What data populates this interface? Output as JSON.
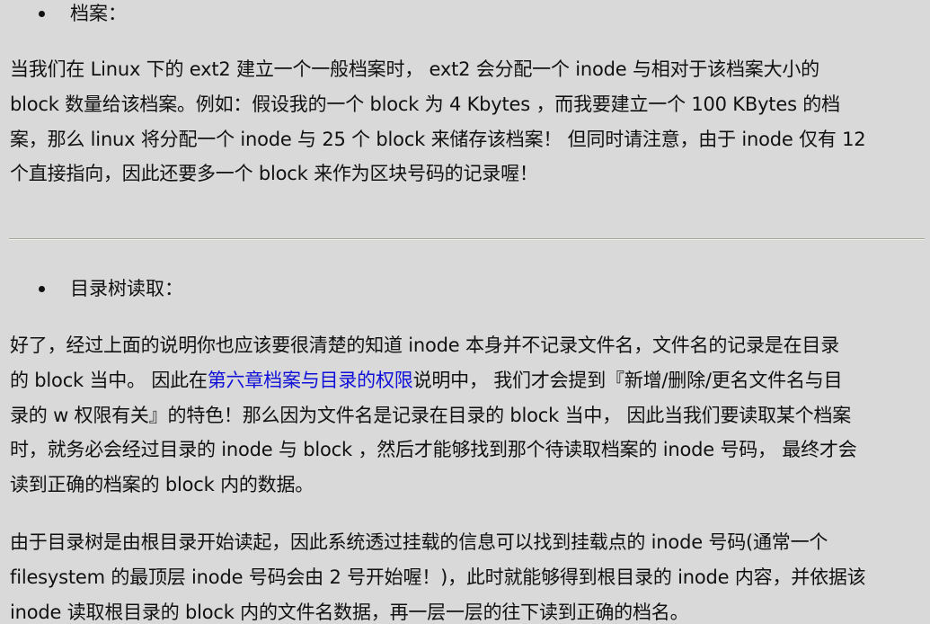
{
  "section1": {
    "bullet": "档案：",
    "lines": [
      "当我们在 Linux 下的 ext2 建立一个一般档案时， ext2 会分配一个 inode 与相对于该档案大小的",
      "block 数量给该档案。例如：假设我的一个 block 为 4 Kbytes ，而我要建立一个 100 KBytes 的档",
      "案，那么 linux 将分配一个 inode 与 25 个 block 来储存该档案！ 但同时请注意，由于 inode 仅有 12",
      "个直接指向，因此还要多一个 block 来作为区块号码的记录喔！"
    ]
  },
  "section2": {
    "bullet": "目录树读取：",
    "para1": {
      "line1": "好了，经过上面的说明你也应该要很清楚的知道 inode 本身并不记录文件名，文件名的记录是在目录",
      "line2_before": "的 block 当中。 因此在",
      "line2_link": "第六章档案与目录的权限",
      "line2_after": "说明中， 我们才会提到『新增/删除/更名文件名与目",
      "line3": "录的 w 权限有关』的特色！那么因为文件名是记录在目录的 block 当中， 因此当我们要读取某个档案",
      "line4": "时，就务必会经过目录的 inode 与 block ，然后才能够找到那个待读取档案的 inode 号码， 最终才会",
      "line5": "读到正确的档案的 block 内的数据。"
    },
    "para2": {
      "lines": [
        "由于目录树是由根目录开始读起，因此系统透过挂载的信息可以找到挂载点的 inode 号码(通常一个",
        "filesystem 的最顶层 inode 号码会由 2 号开始喔！)，此时就能够得到根目录的 inode 内容，并依据该",
        "inode 读取根目录的 block 内的文件名数据，再一层一层的往下读到正确的档名。"
      ]
    }
  },
  "colors": {
    "background": "#d9d9d9",
    "text": "#111111",
    "link": "#1010d8"
  }
}
